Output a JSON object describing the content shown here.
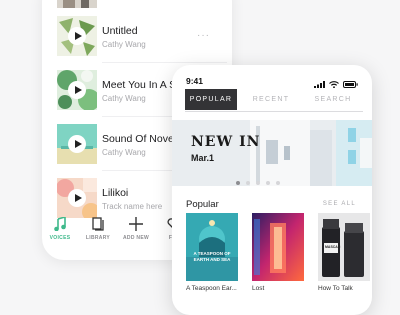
{
  "library_screen": {
    "tracks": [
      {
        "title": "Untitled",
        "subtitle": "Cathy Wang",
        "more": "···"
      },
      {
        "title": "Meet You In A Se",
        "subtitle": "Cathy Wang",
        "more": ""
      },
      {
        "title": "Sound Of Nover",
        "subtitle": "Cathy Wang",
        "more": ""
      },
      {
        "title": "Lilikoi",
        "subtitle": "Track name here",
        "more": ""
      }
    ],
    "tabbar": [
      {
        "label": "VOICES",
        "icon": "music-note-icon",
        "active": true
      },
      {
        "label": "LIBRARY",
        "icon": "library-icon",
        "active": false
      },
      {
        "label": "ADD NEW",
        "icon": "plus-icon",
        "active": false
      },
      {
        "label": "FAV",
        "icon": "heart-icon",
        "active": false
      }
    ],
    "accent_color": "#3fb98b"
  },
  "home_screen": {
    "status_time": "9:41",
    "tabs": [
      {
        "label": "POPULAR",
        "active": true
      },
      {
        "label": "RECENT",
        "active": false
      },
      {
        "label": "SEARCH",
        "active": false
      }
    ],
    "banner": {
      "title": "NEW IN",
      "date": "Mar.1"
    },
    "carousel_page_count": 5,
    "carousel_active_page": 1,
    "popular_title": "Popular",
    "see_all_label": "SEE ALL",
    "books": [
      {
        "title": "A Teaspoon Ear...",
        "cover_text": "A TEASPOON OF EARTH AND SEA"
      },
      {
        "title": "Lost",
        "cover_text": ""
      },
      {
        "title": "How To Talk",
        "cover_text": "MASCAR"
      }
    ],
    "segment_color": "#333336"
  }
}
